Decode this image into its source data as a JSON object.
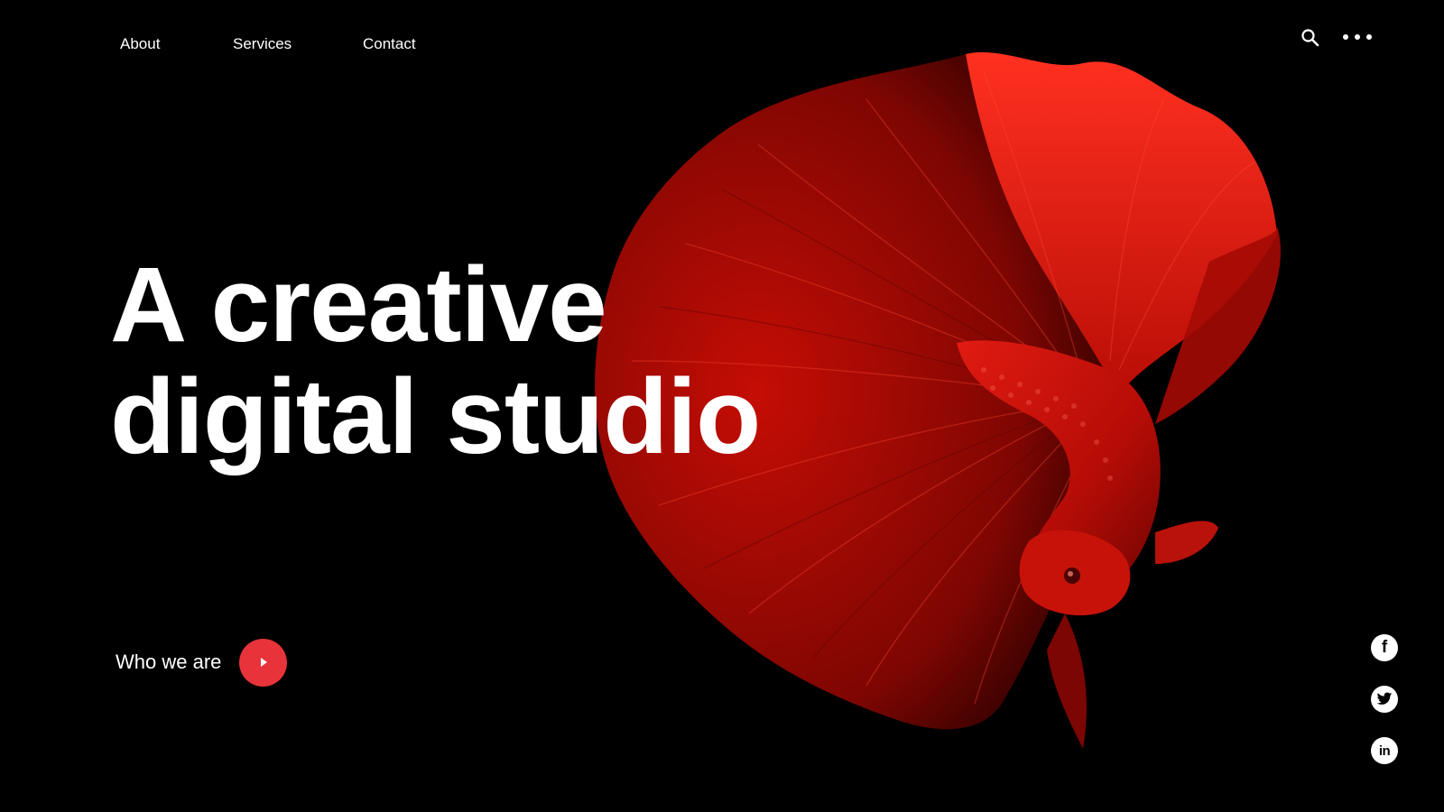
{
  "nav": {
    "items": [
      {
        "label": "About"
      },
      {
        "label": "Services"
      },
      {
        "label": "Contact"
      }
    ]
  },
  "header_actions": {
    "search_icon": "search-icon",
    "more_icon": "more-horizontal-icon"
  },
  "hero": {
    "headline_line1": "A creative",
    "headline_line2": "digital studio",
    "cta_label": "Who we are",
    "cta_icon": "play-icon",
    "image_subject": "red-betta-fish"
  },
  "social": [
    {
      "icon": "facebook-icon",
      "glyph": "f"
    },
    {
      "icon": "twitter-icon"
    },
    {
      "icon": "linkedin-icon",
      "glyph": "in"
    }
  ],
  "colors": {
    "background": "#000000",
    "text": "#ffffff",
    "accent": "#e8333a",
    "fish_red": "#d4150f"
  }
}
